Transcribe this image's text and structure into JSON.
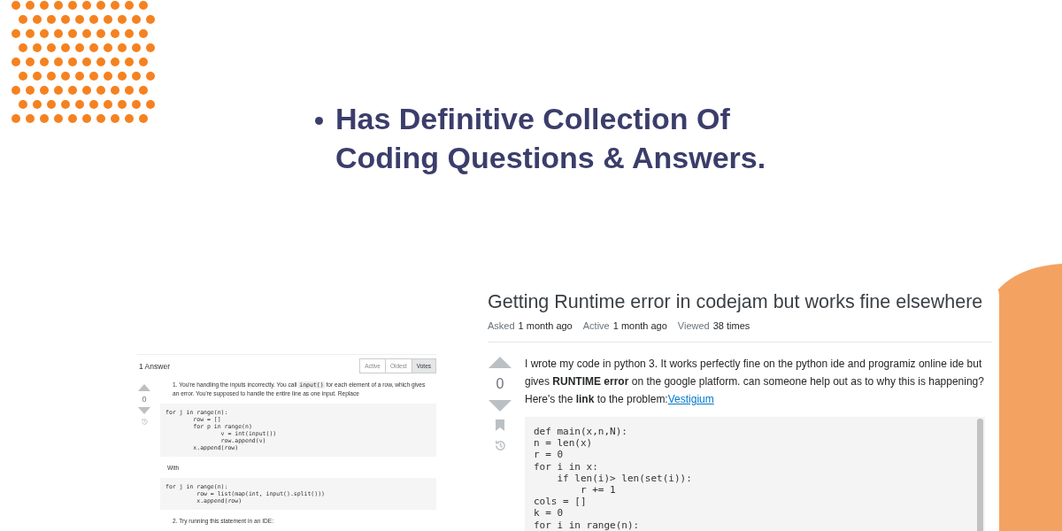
{
  "bullets": [
    "Has Definitive Collection Of Coding Questions & Answers."
  ],
  "answers_panel": {
    "heading": "1 Answer",
    "sort_tabs": [
      {
        "label": "Active",
        "selected": false
      },
      {
        "label": "Oldest",
        "selected": false
      },
      {
        "label": "Votes",
        "selected": true
      }
    ],
    "vote_count": "0",
    "blocks": [
      {
        "kind": "para",
        "segments": [
          {
            "kind": "text",
            "text": "1. You're handling the inputs incorrectly. You call "
          },
          {
            "kind": "code",
            "text": "input()"
          },
          {
            "kind": "text",
            "text": " for each element of a row, which gives an error. You're supposed to handle the entire line as one input. Replace"
          }
        ]
      },
      {
        "kind": "code",
        "lines": [
          "for j in range(n):",
          "        row = []",
          "        for p in range(n)",
          "                v = int(input())",
          "                row.append(v)",
          "        x.append(row)"
        ]
      },
      {
        "kind": "para",
        "segments": [
          {
            "kind": "text",
            "text": "With"
          }
        ]
      },
      {
        "kind": "code",
        "lines": [
          "for j in range(n):",
          "         row = list(map(int, input().split()))",
          "         x.append(row)"
        ]
      },
      {
        "kind": "para",
        "segments": [
          {
            "kind": "text",
            "text": "2. Try running this statement in an IDE:"
          }
        ]
      }
    ]
  },
  "question": {
    "title": "Getting Runtime error in codejam but works fine elsewhere",
    "meta": [
      {
        "label": "Asked",
        "value": "1 month ago"
      },
      {
        "label": "Active",
        "value": "1 month ago"
      },
      {
        "label": "Viewed",
        "value": "38 times"
      }
    ],
    "vote_count": "0",
    "body": "I wrote my code in python 3. It works perfectly fine on the python ide and programiz online ide but gives **RUNTIME error** on the google platform. can someone help out as to why this is happening? Here's the **link** to the problem:",
    "link": "Vestigium",
    "code": [
      "def main(x,n,N):",
      "n = len(x)",
      "r = 0",
      "for i in x:",
      "    if len(i)> len(set(i)):",
      "        r += 1",
      "cols = []",
      "k = 0",
      "for i in range(n):"
    ]
  }
}
